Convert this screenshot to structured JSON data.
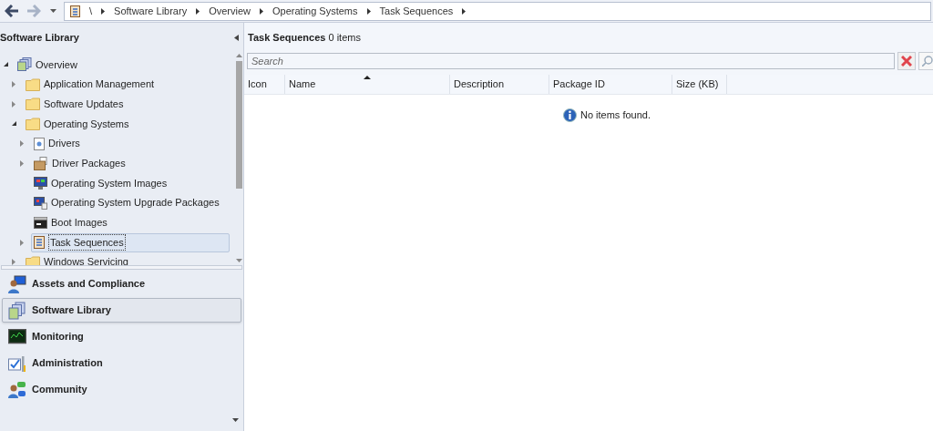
{
  "breadcrumb": [
    "\\",
    "Software Library",
    "Overview",
    "Operating Systems",
    "Task Sequences"
  ],
  "left_panel": {
    "title": "Software Library",
    "tree": [
      {
        "label": "Overview",
        "kind": "overview",
        "expanded": true,
        "selected": false,
        "children": [
          {
            "label": "Application Management",
            "kind": "folder",
            "expanded": false,
            "selected": false
          },
          {
            "label": "Software Updates",
            "kind": "folder",
            "expanded": false,
            "selected": false
          },
          {
            "label": "Operating Systems",
            "kind": "folder",
            "expanded": true,
            "selected": false,
            "children": [
              {
                "label": "Drivers",
                "kind": "driver",
                "expanded": false,
                "selected": false
              },
              {
                "label": "Driver Packages",
                "kind": "package",
                "expanded": false,
                "selected": false
              },
              {
                "label": "Operating System Images",
                "kind": "image",
                "selected": false
              },
              {
                "label": "Operating System Upgrade Packages",
                "kind": "upgrade",
                "selected": false
              },
              {
                "label": "Boot Images",
                "kind": "boot",
                "selected": false
              },
              {
                "label": "Task Sequences",
                "kind": "task",
                "expanded": false,
                "selected": true
              }
            ]
          },
          {
            "label": "Windows Servicing",
            "kind": "folder",
            "expanded": false,
            "selected": false
          }
        ]
      }
    ],
    "workspaces": [
      {
        "label": "Assets and Compliance",
        "kind": "assets",
        "selected": false
      },
      {
        "label": "Software Library",
        "kind": "library",
        "selected": true
      },
      {
        "label": "Monitoring",
        "kind": "monitor",
        "selected": false
      },
      {
        "label": "Administration",
        "kind": "admin",
        "selected": false
      },
      {
        "label": "Community",
        "kind": "community",
        "selected": false
      }
    ]
  },
  "main": {
    "title": "Task Sequences",
    "count": "0 items",
    "search": {
      "placeholder": "Search"
    },
    "table": {
      "columns": [
        {
          "label": "Icon",
          "sorted": false
        },
        {
          "label": "Name",
          "sorted": true
        },
        {
          "label": "Description",
          "sorted": false
        },
        {
          "label": "Package ID",
          "sorted": false
        },
        {
          "label": "Size (KB)",
          "sorted": false
        }
      ]
    },
    "empty_message": "No items found."
  }
}
